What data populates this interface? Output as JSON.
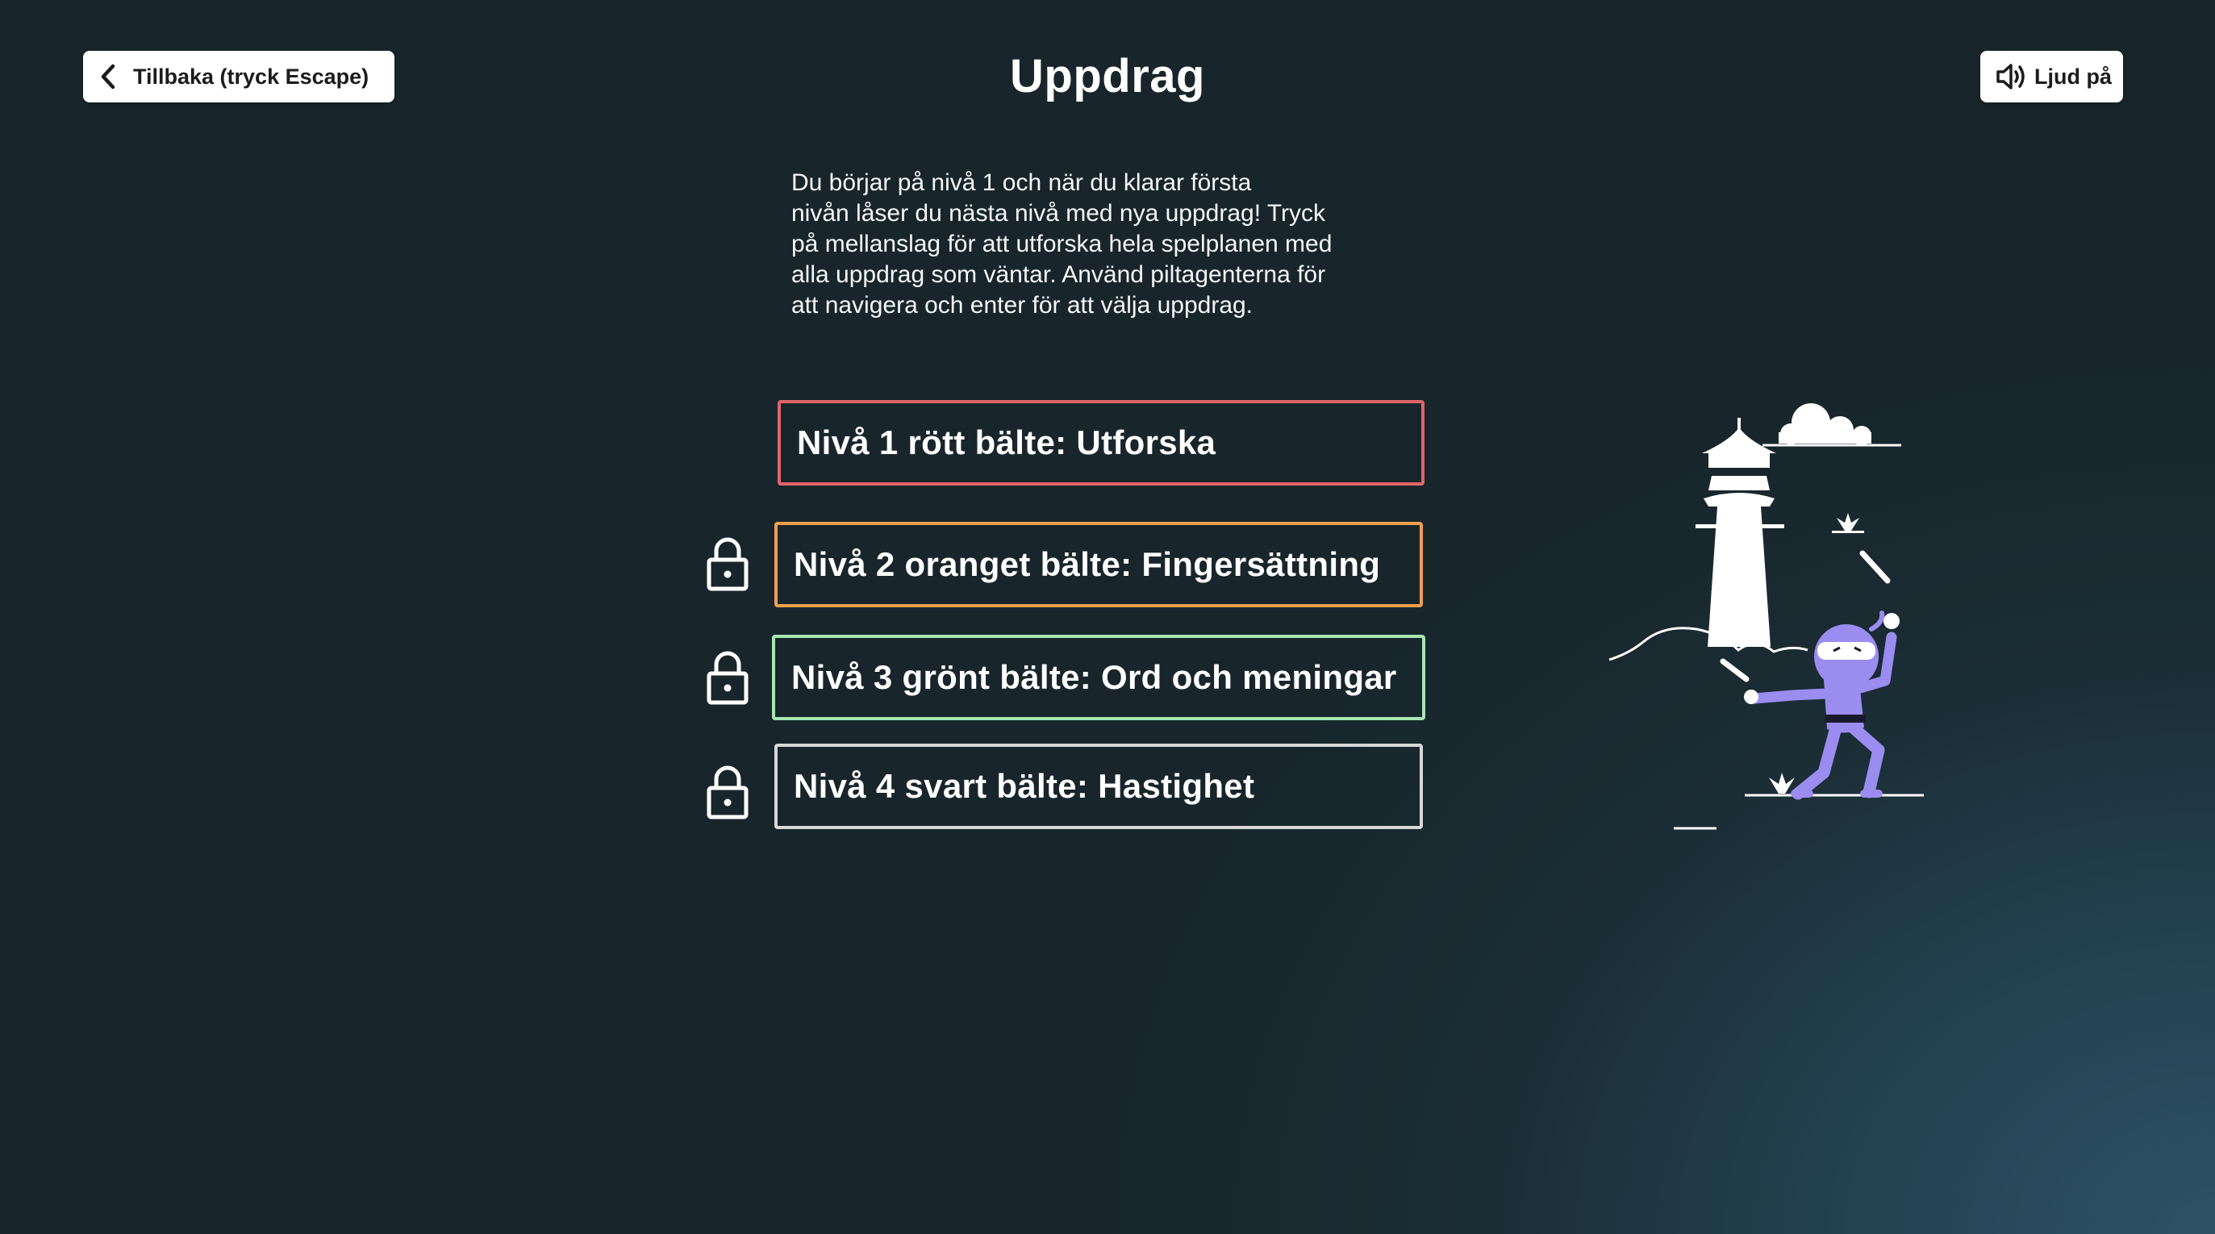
{
  "header": {
    "back_label": "Tillbaka (tryck Escape)",
    "title": "Uppdrag",
    "sound_label": "Ljud på"
  },
  "intro": {
    "text": "Du börjar på nivå 1 och när du klarar första\nnivån låser du nästa nivå med nya uppdrag! Tryck\npå mellanslag för att utforska hela spelplanen med\nalla uppdrag som väntar.  Använd piltagenterna för\natt navigera och enter för att välja uppdrag."
  },
  "levels": [
    {
      "label": "Nivå 1 rött bälte: Utforska",
      "color": "#e0656a",
      "locked": false
    },
    {
      "label": "Nivå 2 oranget bälte: Fingersättning",
      "color": "#f0a04b",
      "locked": true
    },
    {
      "label": "Nivå 3 grönt bälte: Ord och meningar",
      "color": "#a8e6b0",
      "locked": true
    },
    {
      "label": "Nivå 4 svart bälte: Hastighet",
      "color": "#d8d8d8",
      "locked": true
    }
  ],
  "icons": {
    "back": "chevron-left-icon",
    "sound": "speaker-icon",
    "lock": "lock-icon"
  },
  "colors": {
    "background": "#1b2a31",
    "ninja": "#9b8cf0"
  }
}
